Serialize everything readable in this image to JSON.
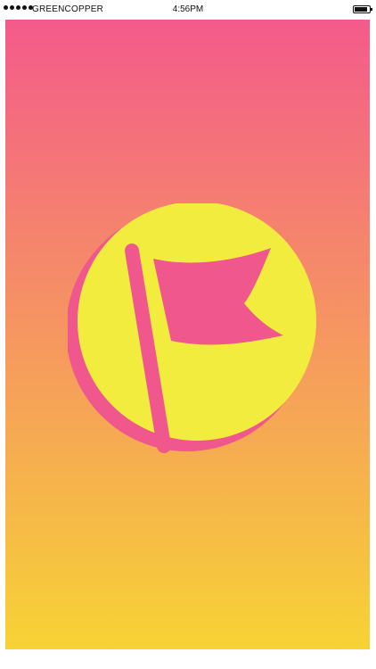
{
  "status_bar": {
    "carrier": "GREENCOPPER",
    "time": "4:56PM",
    "battery_level": 0.9
  },
  "splash": {
    "gradient_top": "#F45A8B",
    "gradient_bottom": "#F7D335",
    "badge_color": "#F2EC3F",
    "badge_shadow_color": "#F0578C",
    "flag_color": "#F0578C",
    "logo_icon": "flag-icon"
  }
}
